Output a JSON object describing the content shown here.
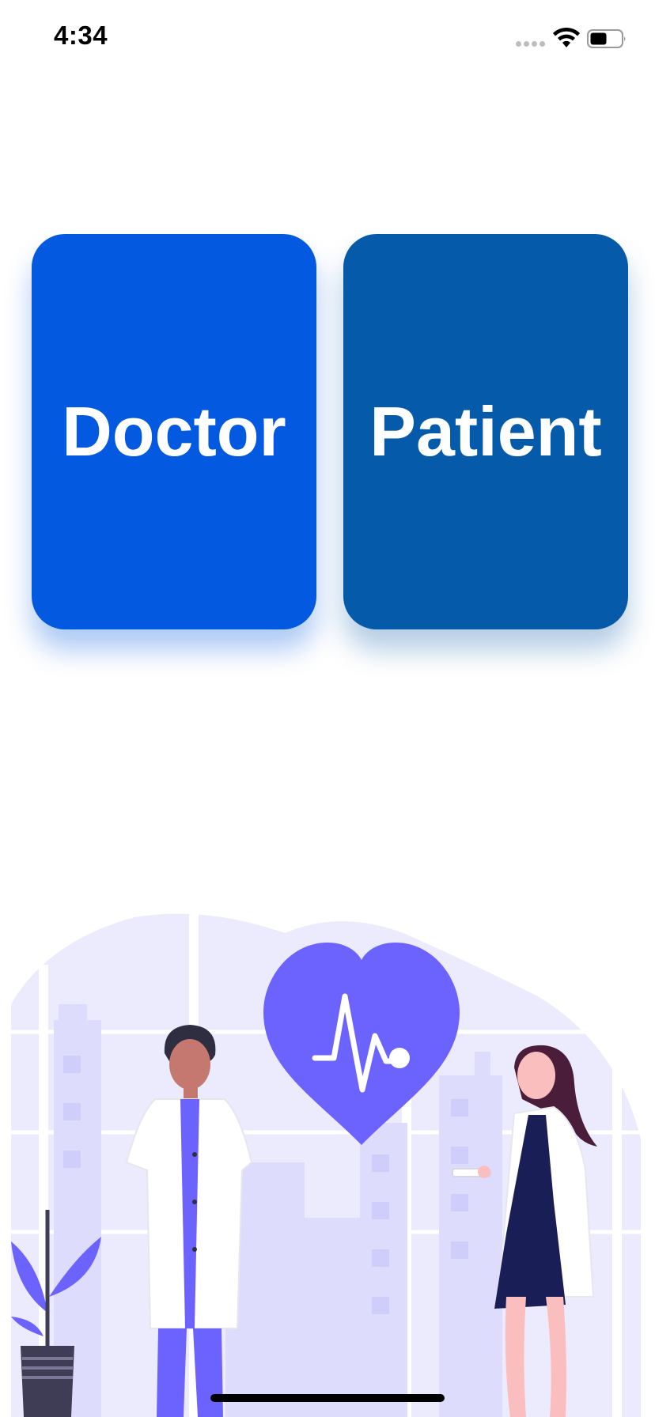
{
  "status_bar": {
    "time": "4:34"
  },
  "roles": {
    "doctor_label": "Doctor",
    "patient_label": "Patient"
  },
  "colors": {
    "doctor_card": "#0459e1",
    "patient_card": "#065aaa",
    "illustration_accent": "#6c63ff",
    "illustration_background": "#ecebfe"
  },
  "illustration": {
    "icon": "heartbeat-heart-icon"
  }
}
